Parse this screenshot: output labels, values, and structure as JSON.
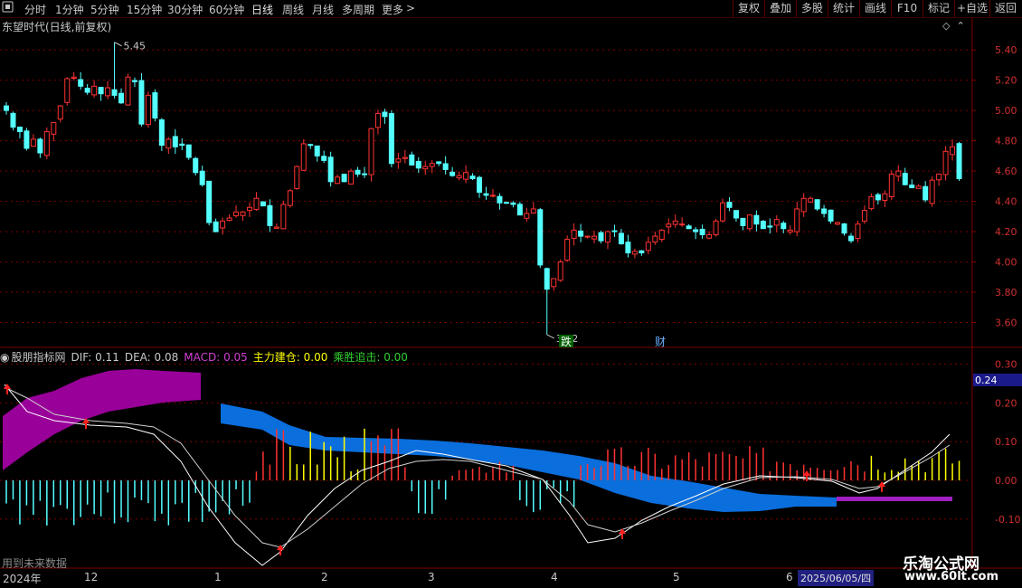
{
  "toolbar": {
    "periods": [
      "分时",
      "1分钟",
      "5分钟",
      "15分钟",
      "30分钟",
      "60分钟",
      "日线",
      "周线",
      "月线",
      "多周期",
      "更多"
    ],
    "active": "日线",
    "more_arrow": ">",
    "menu_box_icon": "menu-square-icon",
    "right": [
      "复权",
      "叠加",
      "多股",
      "统计",
      "画线",
      "F10",
      "标记",
      "+自选",
      "返回"
    ]
  },
  "stock": {
    "title": "东望时代(日线,前复权)",
    "max_label": "5.45",
    "min_label": "3.52",
    "event_die": "跌",
    "event_cai": "财"
  },
  "price_axis": [
    "5.40",
    "5.20",
    "5.00",
    "4.80",
    "4.60",
    "4.40",
    "4.20",
    "4.00",
    "3.80",
    "3.60"
  ],
  "indicator": {
    "name": "股朋指标网",
    "dif": "DIF: 0.11",
    "dea": "DEA: 0.08",
    "macd": "MACD: 0.05",
    "zhuli": "主力建仓: 0.00",
    "chengsheng": "乘胜追击: 0.00",
    "axis": [
      "0.30",
      "0.20",
      "0.10",
      "0.00",
      "-0.10"
    ],
    "current_value": "0.24"
  },
  "footer": {
    "future": "用到未来数据",
    "x_labels": [
      "2024年",
      "12",
      "1",
      "2",
      "3",
      "4",
      "5",
      "6"
    ],
    "date": "2025/06/05/四"
  },
  "watermark": {
    "line1": "乐淘公式网",
    "line2": "www.60lt.com"
  },
  "colors": {
    "up": "#ff3232",
    "down": "#54ffff",
    "grid": "#800000",
    "purple": "#990099",
    "blue": "#0a6edc",
    "yellow": "#ffff00"
  },
  "chart_data": {
    "type": "candlestick",
    "ylim": [
      3.46,
      5.55
    ],
    "highest": 5.45,
    "lowest": 3.52,
    "closes": [
      5.0,
      4.89,
      4.86,
      4.75,
      4.81,
      4.72,
      4.86,
      4.92,
      5.03,
      5.21,
      5.22,
      5.16,
      5.12,
      5.16,
      5.11,
      5.15,
      5.1,
      5.05,
      5.22,
      5.19,
      4.91,
      5.1,
      4.95,
      4.77,
      4.81,
      4.76,
      4.77,
      4.69,
      4.59,
      4.51,
      4.26,
      4.2,
      4.27,
      4.29,
      4.33,
      4.33,
      4.36,
      4.42,
      4.37,
      4.24,
      4.23,
      4.38,
      4.47,
      4.63,
      4.78,
      4.77,
      4.7,
      4.67,
      4.53,
      4.56,
      4.53,
      4.6,
      4.58,
      4.58,
      4.88,
      4.98,
      4.96,
      4.65,
      4.68,
      4.69,
      4.64,
      4.62,
      4.63,
      4.65,
      4.65,
      4.61,
      4.57,
      4.57,
      4.59,
      4.55,
      4.46,
      4.44,
      4.44,
      4.39,
      4.39,
      4.38,
      4.31,
      4.32,
      4.35,
      3.98,
      3.82,
      3.89,
      4.0,
      4.15,
      4.21,
      4.17,
      4.17,
      4.17,
      4.14,
      4.2,
      4.2,
      4.12,
      4.06,
      4.07,
      4.06,
      4.13,
      4.17,
      4.21,
      4.25,
      4.27,
      4.25,
      4.22,
      4.2,
      4.18,
      4.18,
      4.27,
      4.39,
      4.36,
      4.29,
      4.24,
      4.31,
      4.25,
      4.22,
      4.23,
      4.28,
      4.22,
      4.21,
      4.35,
      4.42,
      4.42,
      4.35,
      4.32,
      4.27,
      4.26,
      4.19,
      4.14,
      4.25,
      4.34,
      4.43,
      4.41,
      4.45,
      4.58,
      4.6,
      4.51,
      4.49,
      4.5,
      4.41,
      4.54,
      4.58,
      4.73,
      4.76,
      4.55
    ]
  }
}
